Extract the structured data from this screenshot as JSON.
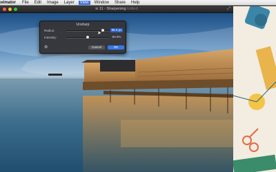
{
  "menubar": {
    "app_name": "xelmator",
    "items": [
      "File",
      "Edit",
      "Image",
      "Layer",
      "View",
      "Window",
      "Share",
      "Help"
    ],
    "active_item": "View"
  },
  "window": {
    "title": "ix 11 - Sharpening",
    "title_suffix": "Edited",
    "traffic_lights": [
      "#ff5f57",
      "#febc2e",
      "#28c840"
    ]
  },
  "dialog": {
    "title": "Unsharp",
    "radius": {
      "label": "Radius:",
      "value": "88.4 px",
      "fraction": 0.85
    },
    "intensity": {
      "label": "Intensity:",
      "value": "50.0%",
      "fraction": 0.5
    },
    "cancel_label": "Cancel",
    "ok_label": "OK"
  }
}
